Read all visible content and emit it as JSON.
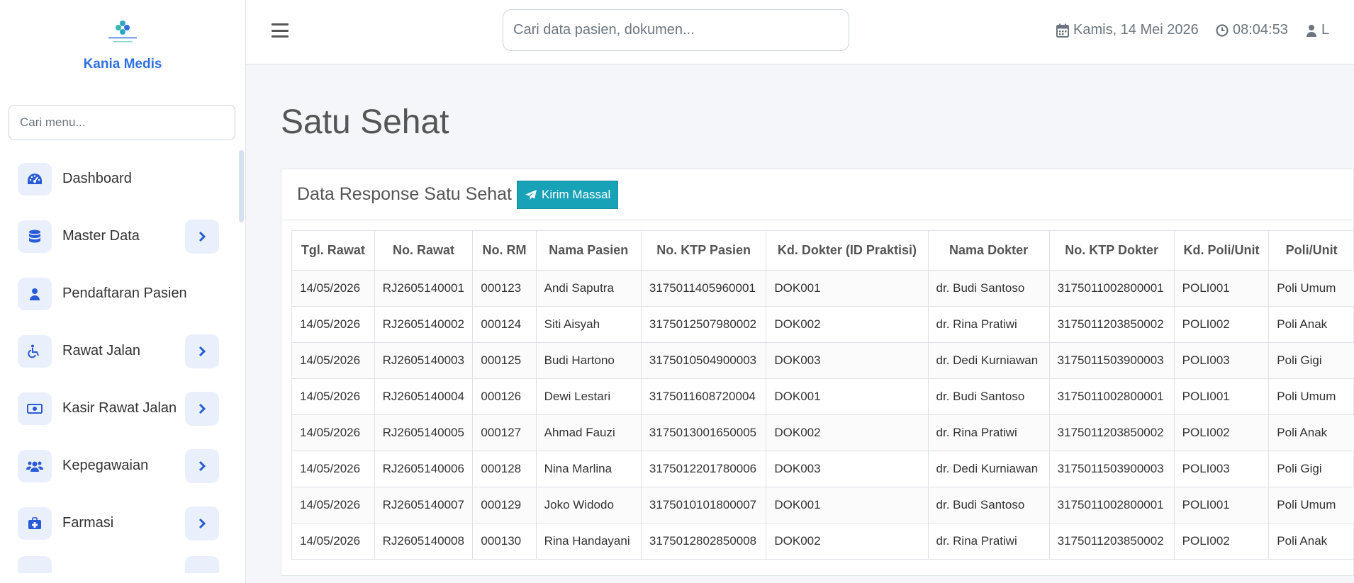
{
  "brand": {
    "name": "Kania Medis",
    "logo_text": "KANIA MEDIS"
  },
  "sidebar": {
    "search_placeholder": "Cari menu...",
    "items": [
      {
        "label": "Dashboard",
        "icon": "dashboard-gauge-icon",
        "has_submenu": false
      },
      {
        "label": "Master Data",
        "icon": "database-icon",
        "has_submenu": true
      },
      {
        "label": "Pendaftaran Pasien",
        "icon": "user-icon",
        "has_submenu": false
      },
      {
        "label": "Rawat Jalan",
        "icon": "wheelchair-icon",
        "has_submenu": true
      },
      {
        "label": "Kasir Rawat Jalan",
        "icon": "money-bill-icon",
        "has_submenu": true
      },
      {
        "label": "Kepegawaian",
        "icon": "users-icon",
        "has_submenu": true
      },
      {
        "label": "Farmasi",
        "icon": "medkit-icon",
        "has_submenu": true
      }
    ]
  },
  "topbar": {
    "search_placeholder": "Cari data pasien, dokumen...",
    "date": "Kamis, 14 Mei 2026",
    "time": "08:04:53",
    "user": "L"
  },
  "page": {
    "title": "Satu Sehat"
  },
  "card": {
    "title": "Data Response Satu Sehat",
    "send_button": "Kirim Massal"
  },
  "table": {
    "headers": [
      "Tgl. Rawat",
      "No. Rawat",
      "No. RM",
      "Nama Pasien",
      "No. KTP Pasien",
      "Kd. Dokter (ID Praktisi)",
      "Nama Dokter",
      "No. KTP Dokter",
      "Kd. Poli/Unit",
      "Poli/Unit"
    ],
    "rows": [
      [
        "14/05/2026",
        "RJ2605140001",
        "000123",
        "Andi Saputra",
        "3175011405960001",
        "DOK001",
        "dr. Budi Santoso",
        "3175011002800001",
        "POLI001",
        "Poli Umum"
      ],
      [
        "14/05/2026",
        "RJ2605140002",
        "000124",
        "Siti Aisyah",
        "3175012507980002",
        "DOK002",
        "dr. Rina Pratiwi",
        "3175011203850002",
        "POLI002",
        "Poli Anak"
      ],
      [
        "14/05/2026",
        "RJ2605140003",
        "000125",
        "Budi Hartono",
        "3175010504900003",
        "DOK003",
        "dr. Dedi Kurniawan",
        "3175011503900003",
        "POLI003",
        "Poli Gigi"
      ],
      [
        "14/05/2026",
        "RJ2605140004",
        "000126",
        "Dewi Lestari",
        "3175011608720004",
        "DOK001",
        "dr. Budi Santoso",
        "3175011002800001",
        "POLI001",
        "Poli Umum"
      ],
      [
        "14/05/2026",
        "RJ2605140005",
        "000127",
        "Ahmad Fauzi",
        "3175013001650005",
        "DOK002",
        "dr. Rina Pratiwi",
        "3175011203850002",
        "POLI002",
        "Poli Anak"
      ],
      [
        "14/05/2026",
        "RJ2605140006",
        "000128",
        "Nina Marlina",
        "3175012201780006",
        "DOK003",
        "dr. Dedi Kurniawan",
        "3175011503900003",
        "POLI003",
        "Poli Gigi"
      ],
      [
        "14/05/2026",
        "RJ2605140007",
        "000129",
        "Joko Widodo",
        "3175010101800007",
        "DOK001",
        "dr. Budi Santoso",
        "3175011002800001",
        "POLI001",
        "Poli Umum"
      ],
      [
        "14/05/2026",
        "RJ2605140008",
        "000130",
        "Rina Handayani",
        "3175012802850008",
        "DOK002",
        "dr. Rina Pratiwi",
        "3175011203850002",
        "POLI002",
        "Poli Anak"
      ]
    ]
  },
  "colors": {
    "accent": "#2f6fe0",
    "button": "#17a2b8",
    "icon_bg": "#eaf0fb"
  }
}
